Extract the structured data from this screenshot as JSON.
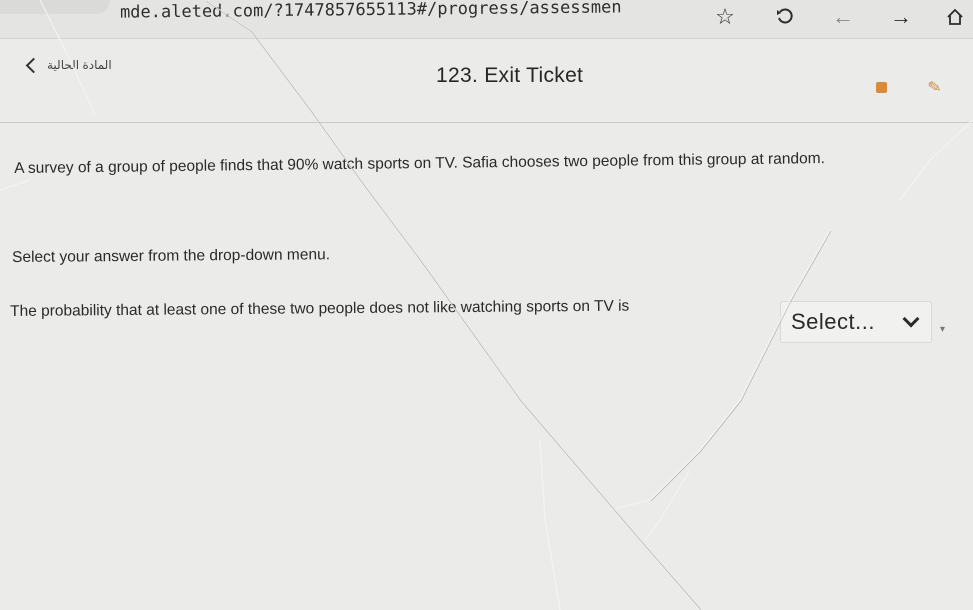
{
  "browser": {
    "url": "mde.aleted.com/?1747857655113#/progress/assessmen"
  },
  "icons": {
    "star": "star-icon",
    "reload": "reload-icon",
    "back": "arrow-left-icon",
    "forward": "arrow-right-icon",
    "home": "home-icon"
  },
  "header": {
    "back_label": "المادة الحالية",
    "title": "123. Exit Ticket"
  },
  "question": {
    "text": "A survey of a group of people finds that 90% watch sports on TV. Safia chooses two people from this group at random.",
    "instruction": "Select your answer from the drop-down menu.",
    "answer_prefix": "The probability that at least one of these two people does not like watching sports on TV is",
    "dropdown_value": "Select..."
  },
  "colors": {
    "accent_flag": "#d98b3a",
    "background": "#ebebe9"
  }
}
